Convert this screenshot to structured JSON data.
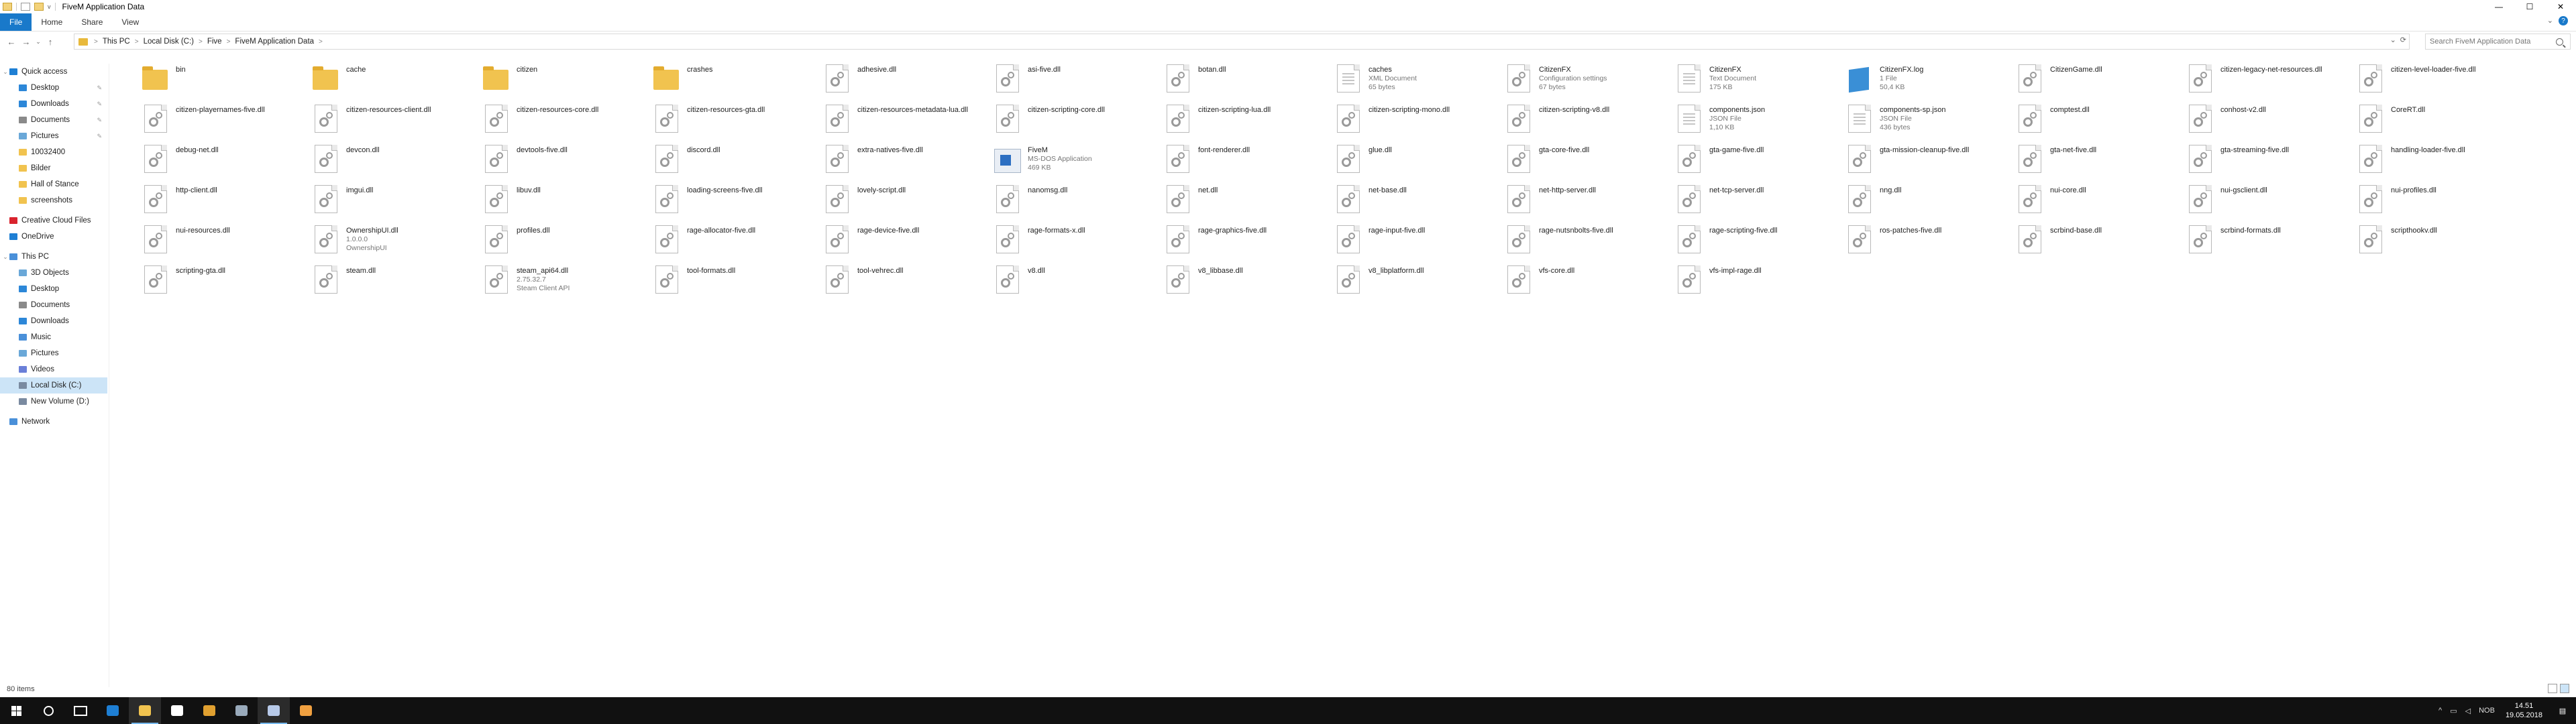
{
  "window": {
    "title": "FiveM Application Data",
    "qa_down": "v",
    "controls": {
      "minimize": "—",
      "maximize": "☐",
      "close": "✕"
    }
  },
  "ribbon": {
    "tabs": [
      "File",
      "Home",
      "Share",
      "View"
    ],
    "expand": "⌄",
    "help": "?"
  },
  "nav": {
    "back": "←",
    "forward": "→",
    "recent": "⌄",
    "up": "↑"
  },
  "address": {
    "crumbs": [
      "This PC",
      "Local Disk (C:)",
      "Five",
      "FiveM Application Data"
    ],
    "separator": ">",
    "refresh": "⟳",
    "dropdown": "⌄"
  },
  "search": {
    "placeholder": "Search FiveM Application Data"
  },
  "sidebar": {
    "items": [
      {
        "label": "Quick access",
        "icon": "star-icon",
        "color": "#1e7fd4",
        "level": 0,
        "caret": "⌄"
      },
      {
        "label": "Desktop",
        "icon": "desktop-icon",
        "color": "#2c87d8",
        "level": 1,
        "pinned": true
      },
      {
        "label": "Downloads",
        "icon": "download-icon",
        "color": "#2c87d8",
        "level": 1,
        "pinned": true
      },
      {
        "label": "Documents",
        "icon": "documents-icon",
        "color": "#8a8a8a",
        "level": 1,
        "pinned": true
      },
      {
        "label": "Pictures",
        "icon": "pictures-icon",
        "color": "#6aa8d8",
        "level": 1,
        "pinned": true
      },
      {
        "label": "10032400",
        "icon": "folder-icon",
        "color": "#f1c34f",
        "level": 1
      },
      {
        "label": "Bilder",
        "icon": "folder-icon",
        "color": "#f1c34f",
        "level": 1
      },
      {
        "label": "Hall of Stance",
        "icon": "folder-icon",
        "color": "#f1c34f",
        "level": 1
      },
      {
        "label": "screenshots",
        "icon": "folder-icon",
        "color": "#f1c34f",
        "level": 1
      },
      {
        "label": "Creative Cloud Files",
        "icon": "creative-cloud-icon",
        "color": "#d9232e",
        "level": 0
      },
      {
        "label": "OneDrive",
        "icon": "onedrive-icon",
        "color": "#1e7fd4",
        "level": 0
      },
      {
        "label": "This PC",
        "icon": "computer-icon",
        "color": "#4a90d9",
        "level": 0,
        "caret": "⌄"
      },
      {
        "label": "3D Objects",
        "icon": "3d-objects-icon",
        "color": "#6aa8d8",
        "level": 1
      },
      {
        "label": "Desktop",
        "icon": "desktop-icon",
        "color": "#2c87d8",
        "level": 1
      },
      {
        "label": "Documents",
        "icon": "documents-icon",
        "color": "#8a8a8a",
        "level": 1
      },
      {
        "label": "Downloads",
        "icon": "download-icon",
        "color": "#2c87d8",
        "level": 1
      },
      {
        "label": "Music",
        "icon": "music-icon",
        "color": "#4a90d9",
        "level": 1
      },
      {
        "label": "Pictures",
        "icon": "pictures-icon",
        "color": "#6aa8d8",
        "level": 1
      },
      {
        "label": "Videos",
        "icon": "videos-icon",
        "color": "#6a7fd8",
        "level": 1
      },
      {
        "label": "Local Disk (C:)",
        "icon": "drive-icon",
        "color": "#7a8aa0",
        "level": 1,
        "active": true
      },
      {
        "label": "New Volume (D:)",
        "icon": "drive-icon",
        "color": "#7a8aa0",
        "level": 1
      },
      {
        "label": "Network",
        "icon": "network-icon",
        "color": "#4a90d9",
        "level": 0
      }
    ]
  },
  "files": [
    {
      "name": "bin",
      "type": "folder"
    },
    {
      "name": "cache",
      "type": "folder"
    },
    {
      "name": "citizen",
      "type": "folder"
    },
    {
      "name": "crashes",
      "type": "folder"
    },
    {
      "name": "adhesive.dll",
      "type": "dll"
    },
    {
      "name": "asi-five.dll",
      "type": "dll"
    },
    {
      "name": "botan.dll",
      "type": "dll"
    },
    {
      "name": "caches",
      "type": "xml",
      "sub1": "XML Document",
      "sub2": "65 bytes"
    },
    {
      "name": "CitizenFX",
      "type": "config",
      "sub1": "Configuration settings",
      "sub2": "67 bytes"
    },
    {
      "name": "CitizenFX",
      "type": "text",
      "sub1": "Text Document",
      "sub2": "175 KB"
    },
    {
      "name": "CitizenFX.log",
      "type": "log",
      "sub1": "1 File",
      "sub2": "50,4 KB"
    },
    {
      "name": "CitizenGame.dll",
      "type": "dll"
    },
    {
      "name": "citizen-legacy-net-resources.dll",
      "type": "dll"
    },
    {
      "name": "citizen-level-loader-five.dll",
      "type": "dll"
    },
    {
      "name": "citizen-playernames-five.dll",
      "type": "dll"
    },
    {
      "name": "citizen-resources-client.dll",
      "type": "dll"
    },
    {
      "name": "citizen-resources-core.dll",
      "type": "dll"
    },
    {
      "name": "citizen-resources-gta.dll",
      "type": "dll"
    },
    {
      "name": "citizen-resources-metadata-lua.dll",
      "type": "dll"
    },
    {
      "name": "citizen-scripting-core.dll",
      "type": "dll"
    },
    {
      "name": "citizen-scripting-lua.dll",
      "type": "dll"
    },
    {
      "name": "citizen-scripting-mono.dll",
      "type": "dll"
    },
    {
      "name": "citizen-scripting-v8.dll",
      "type": "dll"
    },
    {
      "name": "components.json",
      "type": "text",
      "sub1": "JSON File",
      "sub2": "1,10 KB"
    },
    {
      "name": "components-sp.json",
      "type": "text",
      "sub1": "JSON File",
      "sub2": "436 bytes"
    },
    {
      "name": "comptest.dll",
      "type": "dll"
    },
    {
      "name": "conhost-v2.dll",
      "type": "dll"
    },
    {
      "name": "CoreRT.dll",
      "type": "dll"
    },
    {
      "name": "debug-net.dll",
      "type": "dll"
    },
    {
      "name": "devcon.dll",
      "type": "dll"
    },
    {
      "name": "devtools-five.dll",
      "type": "dll"
    },
    {
      "name": "discord.dll",
      "type": "dll"
    },
    {
      "name": "extra-natives-five.dll",
      "type": "dll"
    },
    {
      "name": "FiveM",
      "type": "exe",
      "sub1": "MS-DOS Application",
      "sub2": "469 KB"
    },
    {
      "name": "font-renderer.dll",
      "type": "dll"
    },
    {
      "name": "glue.dll",
      "type": "dll"
    },
    {
      "name": "gta-core-five.dll",
      "type": "dll"
    },
    {
      "name": "gta-game-five.dll",
      "type": "dll"
    },
    {
      "name": "gta-mission-cleanup-five.dll",
      "type": "dll"
    },
    {
      "name": "gta-net-five.dll",
      "type": "dll"
    },
    {
      "name": "gta-streaming-five.dll",
      "type": "dll"
    },
    {
      "name": "handling-loader-five.dll",
      "type": "dll"
    },
    {
      "name": "http-client.dll",
      "type": "dll"
    },
    {
      "name": "imgui.dll",
      "type": "dll"
    },
    {
      "name": "libuv.dll",
      "type": "dll"
    },
    {
      "name": "loading-screens-five.dll",
      "type": "dll"
    },
    {
      "name": "lovely-script.dll",
      "type": "dll"
    },
    {
      "name": "nanomsg.dll",
      "type": "dll"
    },
    {
      "name": "net.dll",
      "type": "dll"
    },
    {
      "name": "net-base.dll",
      "type": "dll"
    },
    {
      "name": "net-http-server.dll",
      "type": "dll"
    },
    {
      "name": "net-tcp-server.dll",
      "type": "dll"
    },
    {
      "name": "nng.dll",
      "type": "dll"
    },
    {
      "name": "nui-core.dll",
      "type": "dll"
    },
    {
      "name": "nui-gsclient.dll",
      "type": "dll"
    },
    {
      "name": "nui-profiles.dll",
      "type": "dll"
    },
    {
      "name": "nui-resources.dll",
      "type": "dll"
    },
    {
      "name": "OwnershipUI.dll",
      "type": "dll",
      "sub1": "1.0.0.0",
      "sub2": "OwnershipUI"
    },
    {
      "name": "profiles.dll",
      "type": "dll"
    },
    {
      "name": "rage-allocator-five.dll",
      "type": "dll"
    },
    {
      "name": "rage-device-five.dll",
      "type": "dll"
    },
    {
      "name": "rage-formats-x.dll",
      "type": "dll"
    },
    {
      "name": "rage-graphics-five.dll",
      "type": "dll"
    },
    {
      "name": "rage-input-five.dll",
      "type": "dll"
    },
    {
      "name": "rage-nutsnbolts-five.dll",
      "type": "dll"
    },
    {
      "name": "rage-scripting-five.dll",
      "type": "dll"
    },
    {
      "name": "ros-patches-five.dll",
      "type": "dll"
    },
    {
      "name": "scrbind-base.dll",
      "type": "dll"
    },
    {
      "name": "scrbind-formats.dll",
      "type": "dll"
    },
    {
      "name": "scripthookv.dll",
      "type": "dll"
    },
    {
      "name": "scripting-gta.dll",
      "type": "dll"
    },
    {
      "name": "steam.dll",
      "type": "dll"
    },
    {
      "name": "steam_api64.dll",
      "type": "dll",
      "sub1": "2.75.32.7",
      "sub2": "Steam Client API"
    },
    {
      "name": "tool-formats.dll",
      "type": "dll"
    },
    {
      "name": "tool-vehrec.dll",
      "type": "dll"
    },
    {
      "name": "v8.dll",
      "type": "dll"
    },
    {
      "name": "v8_libbase.dll",
      "type": "dll"
    },
    {
      "name": "v8_libplatform.dll",
      "type": "dll"
    },
    {
      "name": "vfs-core.dll",
      "type": "dll"
    },
    {
      "name": "vfs-impl-rage.dll",
      "type": "dll"
    }
  ],
  "status": {
    "count": "80 items"
  },
  "taskbar": {
    "apps": [
      {
        "name": "start-button",
        "icon": "windows-icon"
      },
      {
        "name": "taskbar-search",
        "icon": "search-icon"
      },
      {
        "name": "taskbar-task-view",
        "icon": "task-view-icon"
      },
      {
        "name": "taskbar-edge",
        "icon": "edge-icon",
        "color": "#1e7fd4"
      },
      {
        "name": "taskbar-explorer",
        "icon": "folder-icon",
        "color": "#f1c34f",
        "active": true
      },
      {
        "name": "taskbar-store",
        "icon": "store-icon",
        "color": "#ffffff"
      },
      {
        "name": "taskbar-chrome",
        "icon": "chrome-icon",
        "color": "#e0a030"
      },
      {
        "name": "taskbar-steam",
        "icon": "steam-icon",
        "color": "#9ab"
      },
      {
        "name": "taskbar-explorer-2",
        "icon": "window-icon",
        "color": "#b7c9e8",
        "active": true
      },
      {
        "name": "taskbar-fivem",
        "icon": "fivem-icon",
        "color": "#f0a040"
      }
    ],
    "tray": {
      "lang": "NOB",
      "time": "14.51",
      "date": "19.05.2018"
    }
  }
}
